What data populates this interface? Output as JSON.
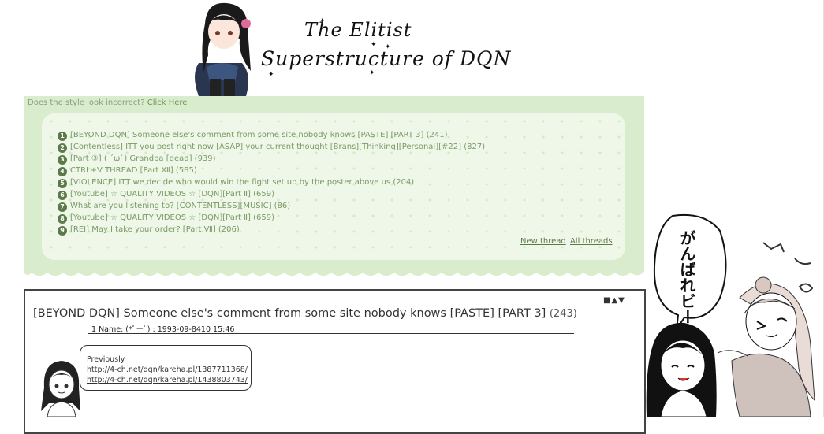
{
  "header": {
    "logo_line1": "The Elitist",
    "logo_line2": "Superstructure of DQN",
    "mascot_icon": "anime-girl-mascot-icon"
  },
  "style_note": {
    "text": "Does the style look incorrect?",
    "link": "Click Here"
  },
  "thread_list": [
    {
      "num": "1",
      "title": "[BEYOND DQN] Someone else's comment from some site nobody knows [PASTE] [PART 3] (241)"
    },
    {
      "num": "2",
      "title": "[Contentless] ITT you post right now [ASAP] your current thought [Brans][Thinking][Personal][#22] (827)"
    },
    {
      "num": "3",
      "title": "[Part ③] ( ´ω`) Grandpa [dead] (939)"
    },
    {
      "num": "4",
      "title": "CTRL+V THREAD [Part Ⅻ] (585)"
    },
    {
      "num": "5",
      "title": "[VIOLENCE] ITT we decide who would win the fight set up by the poster above us (204)"
    },
    {
      "num": "6",
      "title": "[Youtube] ☆ QUALITY VIDEOS ☆ [DQN][Part Ⅱ] (659)"
    },
    {
      "num": "7",
      "title": "What are you listening to? [CONTENTLESS][MUSIC] (86)"
    },
    {
      "num": "8",
      "title": "[Youtube] ☆ QUALITY VIDEOS ☆ [DQN][Part Ⅱ] (659)"
    },
    {
      "num": "9",
      "title": "[REI] May I take your order? [Part Ⅶ] (206)"
    }
  ],
  "nav": {
    "new_thread": "New thread",
    "all_threads": "All threads"
  },
  "thread": {
    "controls": "■▲▼",
    "title": "[BEYOND DQN] Someone else's comment from some site nobody knows [PASTE] [PART 3]",
    "count": "(243)",
    "post": {
      "header": "1  Name: (*ﾟーﾟ) : 1993-09-8410 15:46",
      "intro": "Previously",
      "links": [
        "http://4-ch.net/dqn/kareha.pl/1387711368/",
        "http://4-ch.net/dqn/kareha.pl/1438803743/"
      ]
    }
  },
  "manga": {
    "speech": "がんばれビーム"
  }
}
